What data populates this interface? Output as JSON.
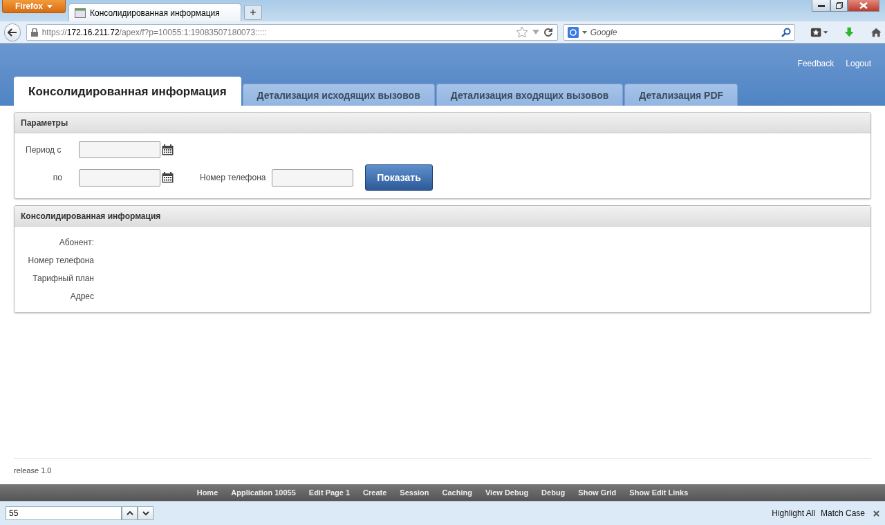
{
  "browser": {
    "menu_button": "Firefox",
    "tabs": [
      {
        "title": "Консолидированная информация",
        "selected": true
      }
    ],
    "new_tab": "+",
    "url": {
      "scheme": "https://",
      "host": "172.16.211.72",
      "path": "/apex/f?p=10055:1:19083507180073:::::"
    },
    "search": {
      "engine_placeholder": "Google"
    }
  },
  "header": {
    "links": [
      "Feedback",
      "Logout"
    ]
  },
  "tabs": [
    {
      "label": "Консолидированная информация",
      "selected": true
    },
    {
      "label": "Детализация исходящих вызовов",
      "selected": false
    },
    {
      "label": "Детализация входящих вызовов",
      "selected": false
    },
    {
      "label": "Детализация PDF",
      "selected": false
    }
  ],
  "parameters": {
    "title": "Параметры",
    "from_label": "Период с",
    "to_label": "по",
    "phone_label": "Номер телефона",
    "button": "Показать"
  },
  "info": {
    "title": "Консолидированная информация",
    "labels": [
      "Абонент:",
      "Номер телефона",
      "Тарифный план",
      "Адрес"
    ]
  },
  "footer": {
    "release": "release 1.0"
  },
  "dev_toolbar": [
    "Home",
    "Application 10055",
    "Edit Page 1",
    "Create",
    "Session",
    "Caching",
    "View Debug",
    "Debug",
    "Show Grid",
    "Show Edit Links"
  ],
  "find_bar": {
    "value": "55",
    "options": [
      "Highlight All",
      "Match Case"
    ]
  }
}
